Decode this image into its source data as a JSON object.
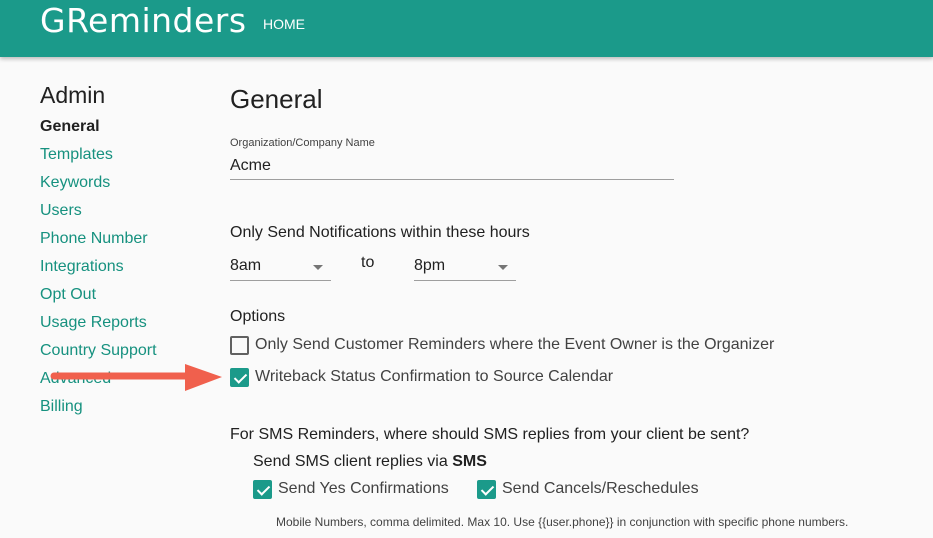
{
  "header": {
    "logo": "GReminders",
    "nav_home": "HOME"
  },
  "sidebar": {
    "title": "Admin",
    "items": [
      {
        "label": "General",
        "active": true
      },
      {
        "label": "Templates"
      },
      {
        "label": "Keywords"
      },
      {
        "label": "Users"
      },
      {
        "label": "Phone Number"
      },
      {
        "label": "Integrations"
      },
      {
        "label": "Opt Out"
      },
      {
        "label": "Usage Reports"
      },
      {
        "label": "Country Support"
      },
      {
        "label": "Advanced"
      },
      {
        "label": "Billing"
      }
    ]
  },
  "main": {
    "title": "General",
    "org_label": "Organization/Company Name",
    "org_value": "Acme",
    "hours_label": "Only Send Notifications within these hours",
    "hours_from": "8am",
    "hours_to_word": "to",
    "hours_to": "8pm",
    "options_label": "Options",
    "option1": {
      "label": "Only Send Customer Reminders where the Event Owner is the Organizer",
      "checked": false
    },
    "option2": {
      "label": "Writeback Status Confirmation to Source Calendar",
      "checked": true
    },
    "sms_question": "For SMS Reminders, where should SMS replies from your client be sent?",
    "sms_via_prefix": "Send SMS client replies via",
    "sms_via_value": "SMS",
    "sms_yes": {
      "label": "Send Yes Confirmations",
      "checked": true
    },
    "sms_cancel": {
      "label": "Send Cancels/Reschedules",
      "checked": true
    },
    "note": "Mobile Numbers, comma delimited. Max 10. Use {{user.phone}} in conjunction with specific phone numbers."
  },
  "colors": {
    "brand": "#1b9a8a",
    "link": "#16917f",
    "arrow": "#f0604d"
  }
}
